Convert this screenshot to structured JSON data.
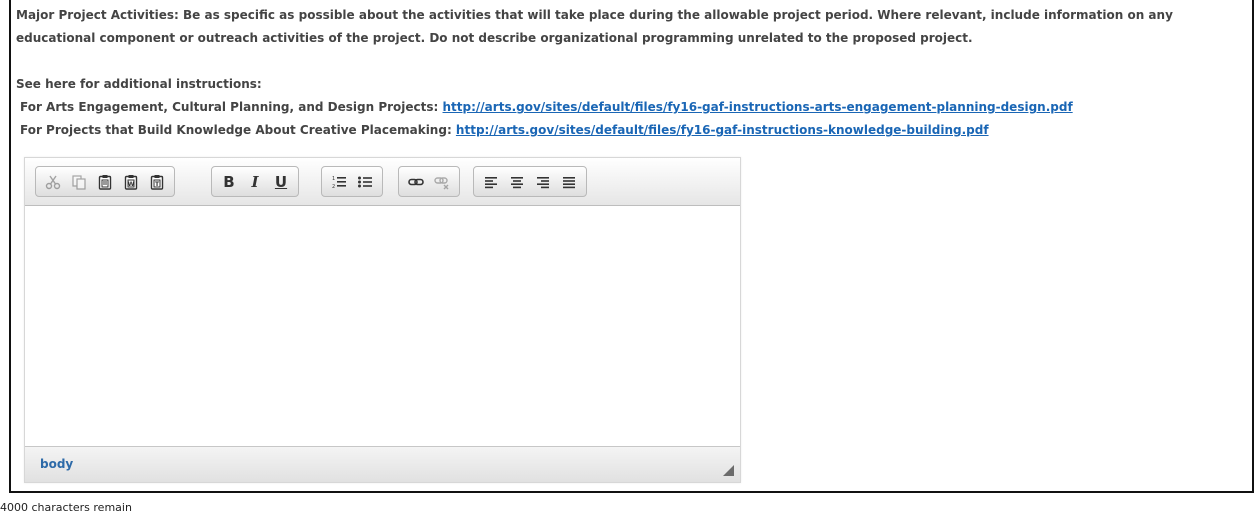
{
  "instructions": {
    "para1": "Major Project Activities:  Be as specific as possible about the activities that will take place during the allowable project period. Where relevant, include information on any educational component or outreach activities of the project. Do not describe organizational programming unrelated to the proposed project.",
    "see_here": "See here for additional instructions:",
    "link1_prefix": "For Arts Engagement, Cultural Planning, and Design Projects: ",
    "link1_url": "http://arts.gov/sites/default/files/fy16-gaf-instructions-arts-engagement-planning-design.pdf",
    "link2_prefix": "For Projects that Build Knowledge About Creative Placemaking: ",
    "link2_url": "http://arts.gov/sites/default/files/fy16-gaf-instructions-knowledge-building.pdf"
  },
  "toolbar": {
    "groups": [
      {
        "buttons": [
          "cut-icon",
          "copy-icon",
          "paste-icon",
          "paste-text-icon",
          "paste-word-icon"
        ]
      },
      {
        "buttons": [
          "bold-icon",
          "italic-icon",
          "underline-icon"
        ],
        "labels": {
          "bold": "B",
          "italic": "I",
          "underline": "U"
        }
      },
      {
        "buttons": [
          "numbered-list-icon",
          "bulleted-list-icon"
        ]
      },
      {
        "buttons": [
          "link-icon",
          "unlink-icon"
        ]
      },
      {
        "buttons": [
          "align-left-icon",
          "align-center-icon",
          "align-right-icon",
          "align-justify-icon"
        ]
      }
    ]
  },
  "editor": {
    "content": "",
    "status_path": "body"
  },
  "footer": {
    "characters_remaining": "4000 characters remain"
  },
  "colors": {
    "link": "#1a66b5",
    "status_path": "#2d6aa8",
    "frame_border": "#111111"
  }
}
